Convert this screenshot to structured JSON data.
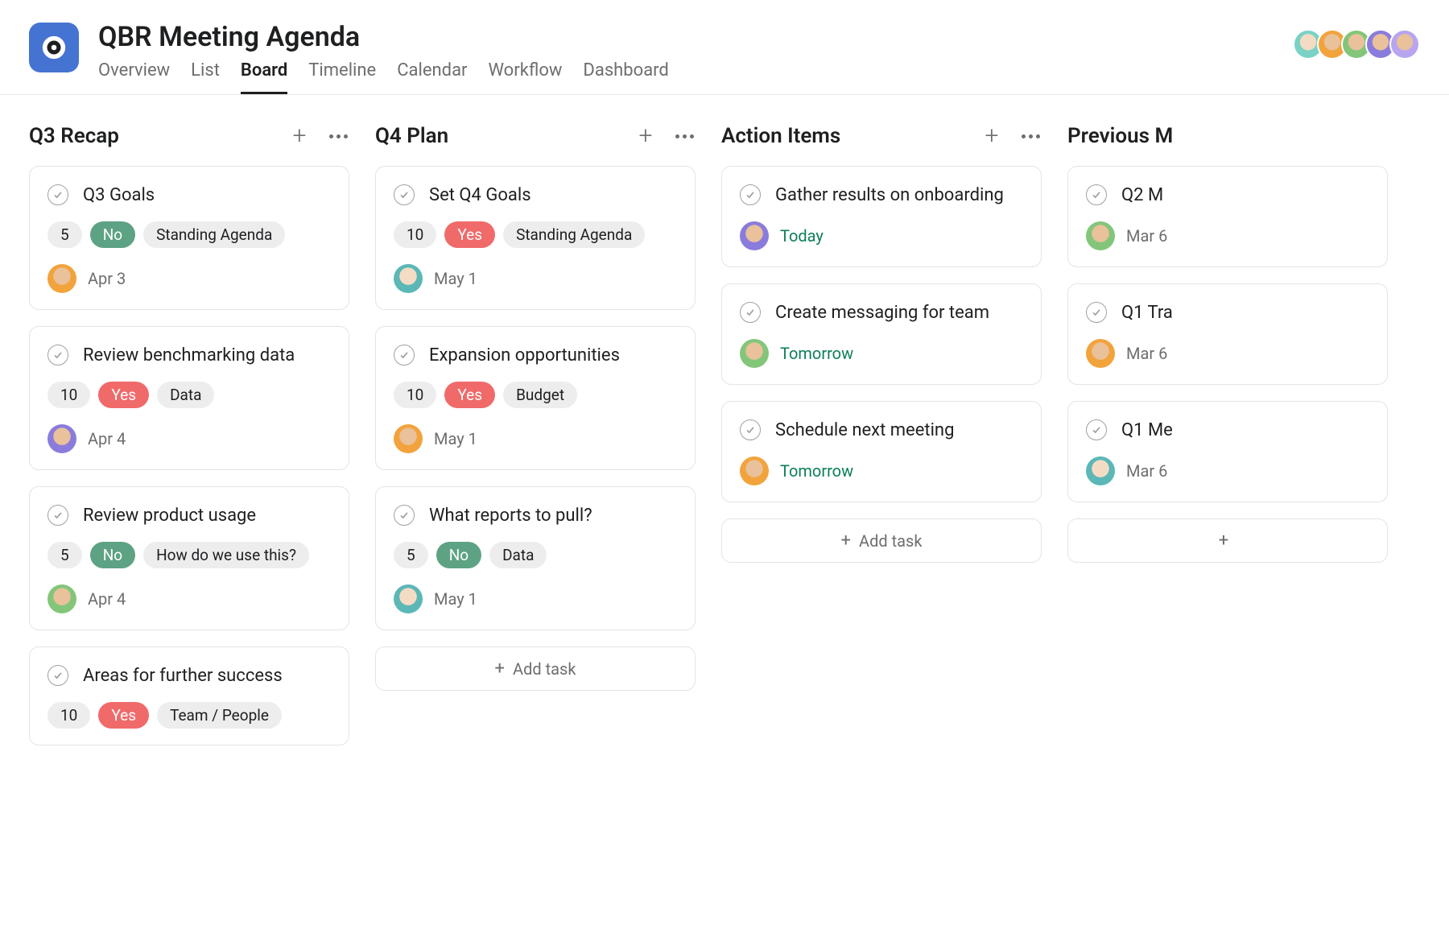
{
  "project": {
    "title": "QBR Meeting Agenda",
    "icon_color": "#4573d2"
  },
  "tabs": [
    "Overview",
    "List",
    "Board",
    "Timeline",
    "Calendar",
    "Workflow",
    "Dashboard"
  ],
  "active_tab": "Board",
  "collaborators": [
    {
      "avatar_class": "av-teal"
    },
    {
      "avatar_class": "av-orange"
    },
    {
      "avatar_class": "av-green"
    },
    {
      "avatar_class": "av-purple"
    },
    {
      "avatar_class": "av-lav"
    }
  ],
  "columns": [
    {
      "title": "Q3 Recap",
      "show_actions": true,
      "cards": [
        {
          "title": "Q3 Goals",
          "pills": [
            {
              "text": "5",
              "kind": "gray"
            },
            {
              "text": "No",
              "kind": "green"
            },
            {
              "text": "Standing Agenda",
              "kind": "gray"
            }
          ],
          "assignee_avatar": "av-orange",
          "due": "Apr 3",
          "due_green": false
        },
        {
          "title": "Review benchmarking data",
          "pills": [
            {
              "text": "10",
              "kind": "gray"
            },
            {
              "text": "Yes",
              "kind": "red"
            },
            {
              "text": "Data",
              "kind": "gray"
            }
          ],
          "assignee_avatar": "av-purple",
          "due": "Apr 4",
          "due_green": false
        },
        {
          "title": "Review product usage",
          "pills": [
            {
              "text": "5",
              "kind": "gray"
            },
            {
              "text": "No",
              "kind": "green"
            },
            {
              "text": "How do we use this?",
              "kind": "gray"
            }
          ],
          "assignee_avatar": "av-green",
          "due": "Apr 4",
          "due_green": false
        },
        {
          "title": "Areas for further success",
          "pills": [
            {
              "text": "10",
              "kind": "gray"
            },
            {
              "text": "Yes",
              "kind": "red"
            },
            {
              "text": "Team / People",
              "kind": "gray"
            }
          ],
          "assignee_avatar": null,
          "due": null,
          "due_green": false
        }
      ],
      "add_task_label": null
    },
    {
      "title": "Q4 Plan",
      "show_actions": true,
      "cards": [
        {
          "title": "Set Q4 Goals",
          "pills": [
            {
              "text": "10",
              "kind": "gray"
            },
            {
              "text": "Yes",
              "kind": "red"
            },
            {
              "text": "Standing Agenda",
              "kind": "gray"
            }
          ],
          "assignee_avatar": "av-tealc",
          "due": "May 1",
          "due_green": false
        },
        {
          "title": "Expansion opportunities",
          "pills": [
            {
              "text": "10",
              "kind": "gray"
            },
            {
              "text": "Yes",
              "kind": "red"
            },
            {
              "text": "Budget",
              "kind": "gray"
            }
          ],
          "assignee_avatar": "av-orange",
          "due": "May 1",
          "due_green": false
        },
        {
          "title": "What reports to pull?",
          "pills": [
            {
              "text": "5",
              "kind": "gray"
            },
            {
              "text": "No",
              "kind": "green"
            },
            {
              "text": "Data",
              "kind": "gray"
            }
          ],
          "assignee_avatar": "av-tealc",
          "due": "May 1",
          "due_green": false
        }
      ],
      "add_task_label": "Add task"
    },
    {
      "title": "Action Items",
      "show_actions": true,
      "cards": [
        {
          "title": "Gather results on onboarding",
          "pills": [],
          "assignee_avatar": "av-purple",
          "due": "Today",
          "due_green": true
        },
        {
          "title": "Create messaging for team",
          "pills": [],
          "assignee_avatar": "av-green",
          "due": "Tomorrow",
          "due_green": true
        },
        {
          "title": "Schedule next meeting",
          "pills": [],
          "assignee_avatar": "av-orange",
          "due": "Tomorrow",
          "due_green": true
        }
      ],
      "add_task_label": "Add task"
    },
    {
      "title": "Previous M",
      "show_actions": false,
      "cards": [
        {
          "title": "Q2 M",
          "pills": [],
          "assignee_avatar": "av-green",
          "due": "Mar 6",
          "due_green": false
        },
        {
          "title": "Q1 Tra",
          "pills": [],
          "assignee_avatar": "av-orange",
          "due": "Mar 6",
          "due_green": false
        },
        {
          "title": "Q1 Me",
          "pills": [],
          "assignee_avatar": "av-tealc",
          "due": "Mar 6",
          "due_green": false
        }
      ],
      "add_task_label": ""
    }
  ],
  "strings": {
    "add_task_generic": "Add task"
  }
}
